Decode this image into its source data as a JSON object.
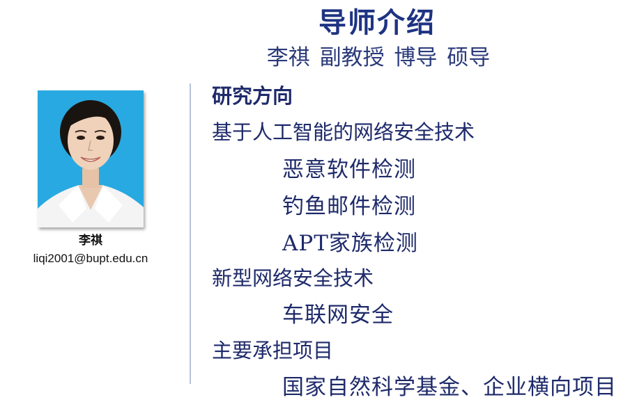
{
  "title": "导师介绍",
  "subtitle": "李祺 副教授 博导 硕导",
  "profile": {
    "name": "李祺",
    "email": "liqi2001@bupt.edu.cn"
  },
  "colors": {
    "heading": "#1e3382",
    "text": "#1e2a6a",
    "photo_background": "#29a9e1",
    "divider": "#b6c2d8"
  },
  "research": {
    "heading": "研究方向",
    "topics": [
      {
        "label": "基于人工智能的网络安全技术",
        "items": [
          "恶意软件检测",
          "钓鱼邮件检测",
          "APT家族检测"
        ]
      },
      {
        "label": "新型网络安全技术",
        "items": [
          "车联网安全"
        ]
      }
    ]
  },
  "projects": {
    "heading": "主要承担项目",
    "items": [
      "国家自然科学基金、企业横向项目"
    ]
  }
}
